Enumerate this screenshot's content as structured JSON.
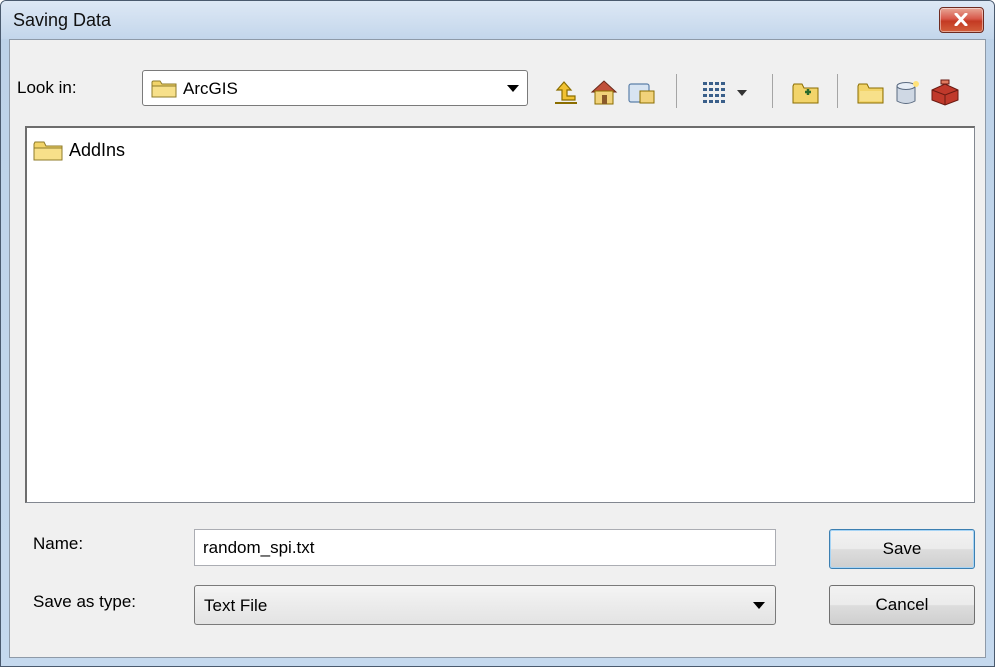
{
  "window": {
    "title": "Saving Data"
  },
  "look_in": {
    "label": "Look in:",
    "value": "ArcGIS"
  },
  "toolbar": {
    "icons": [
      "up-one-level-icon",
      "home-folder-icon",
      "connect-folder-icon",
      "view-menu-icon",
      "new-folder-icon",
      "new-file-geodatabase-icon",
      "new-personal-geodatabase-icon",
      "toolbox-icon"
    ]
  },
  "file_list": {
    "items": [
      {
        "name": "AddIns",
        "icon": "folder-icon"
      }
    ]
  },
  "name_field": {
    "label": "Name:",
    "value": "random_spi.txt"
  },
  "type_field": {
    "label": "Save as type:",
    "value": "Text File"
  },
  "buttons": {
    "save": "Save",
    "cancel": "Cancel"
  },
  "colors": {
    "title_bar": "#c3d6eb",
    "close_button": "#c94a32",
    "folder": "#f2d46a"
  }
}
